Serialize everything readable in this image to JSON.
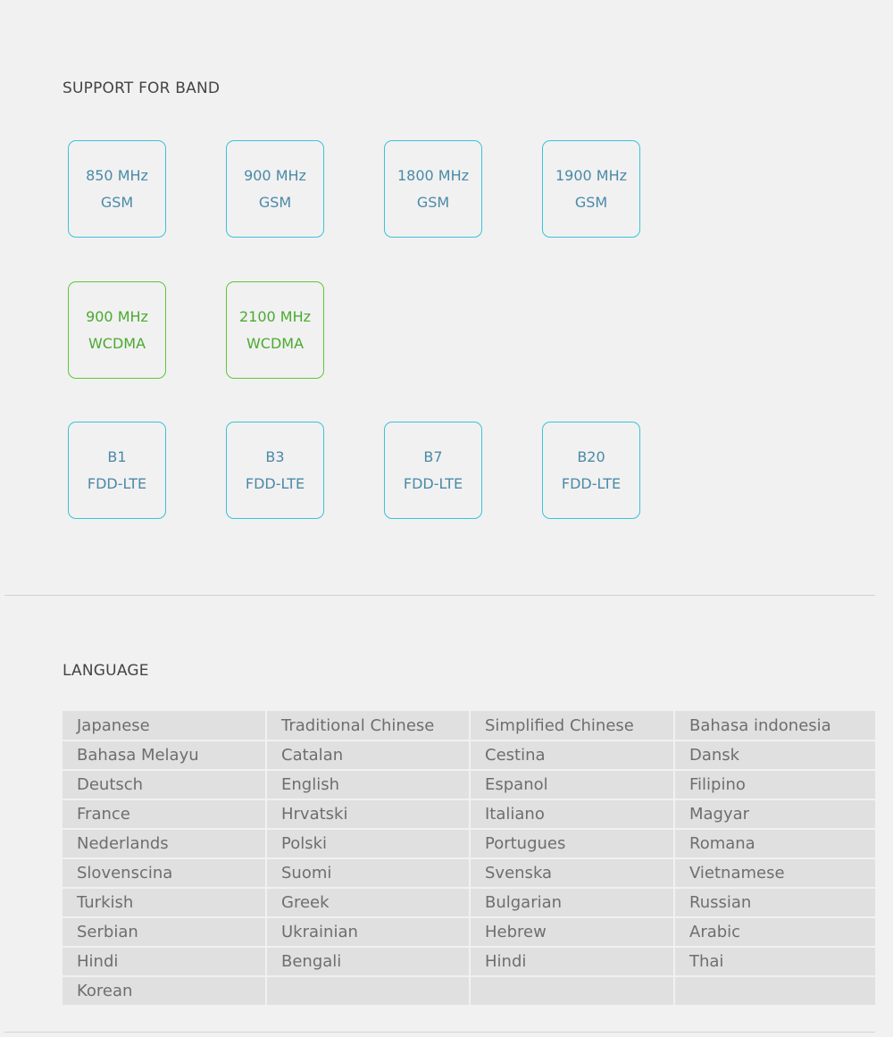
{
  "band_section": {
    "title": "SUPPORT FOR BAND",
    "gsm": [
      {
        "freq": "850 MHz",
        "tech": "GSM"
      },
      {
        "freq": "900 MHz",
        "tech": "GSM"
      },
      {
        "freq": "1800 MHz",
        "tech": "GSM"
      },
      {
        "freq": "1900 MHz",
        "tech": "GSM"
      }
    ],
    "wcdma": [
      {
        "freq": "900 MHz",
        "tech": "WCDMA"
      },
      {
        "freq": "2100 MHz",
        "tech": "WCDMA"
      }
    ],
    "lte": [
      {
        "freq": "B1",
        "tech": "FDD-LTE"
      },
      {
        "freq": "B3",
        "tech": "FDD-LTE"
      },
      {
        "freq": "B7",
        "tech": "FDD-LTE"
      },
      {
        "freq": "B20",
        "tech": "FDD-LTE"
      }
    ]
  },
  "language_section": {
    "title": "LANGUAGE",
    "rows": [
      [
        "Japanese",
        "Traditional Chinese",
        "Simplified Chinese",
        "Bahasa indonesia"
      ],
      [
        "Bahasa Melayu",
        "Catalan",
        "Cestina",
        "Dansk"
      ],
      [
        "Deutsch",
        "English",
        "Espanol",
        "Filipino"
      ],
      [
        "France",
        "Hrvatski",
        "Italiano",
        "Magyar"
      ],
      [
        "Nederlands",
        "Polski",
        "Portugues",
        "Romana"
      ],
      [
        "Slovenscina",
        "Suomi",
        "Svenska",
        "Vietnamese"
      ],
      [
        "Turkish",
        "Greek",
        "Bulgarian",
        "Russian"
      ],
      [
        "Serbian",
        "Ukrainian",
        "Hebrew",
        "Arabic"
      ],
      [
        "Hindi",
        "Bengali",
        "Hindi",
        "Thai"
      ],
      [
        "Korean",
        "",
        "",
        ""
      ]
    ]
  },
  "colors": {
    "background": "#f1f1f1",
    "gsm_lte_border": "#38c4d8",
    "gsm_lte_text": "#4a8aa8",
    "wcdma_border": "#5cc83a",
    "wcdma_text": "#4aaa30",
    "table_cell": "#e0e0e0"
  }
}
